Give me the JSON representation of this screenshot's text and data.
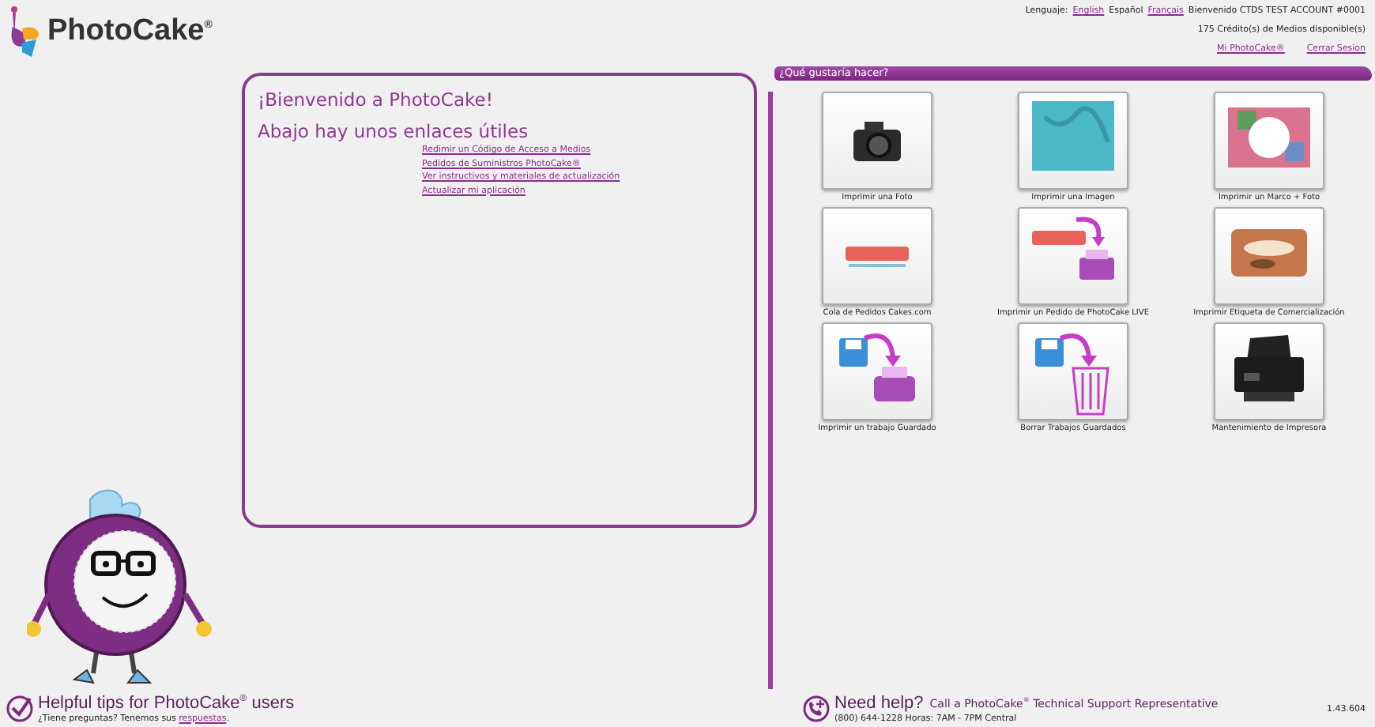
{
  "header": {
    "logo": "PhotoCake$^{®}$",
    "language_label": "Lenguaje:",
    "languages": [
      {
        "label": "English",
        "selected": false
      },
      {
        "label": "Español",
        "selected": true
      },
      {
        "label": "Français",
        "selected": false
      }
    ],
    "welcome_user": "Bienvenido CTDS TEST ACCOUNT #0001",
    "credits": "175 Crédito(s) de Medios disponible(s)",
    "links": [
      "Mi PhotoCake®",
      "Cerrar Sesion"
    ]
  },
  "welcome": {
    "title": "¡Bienvenido a PhotoCake!",
    "subtitle": "Abajo hay unos enlaces útiles",
    "links": [
      "Redimir un Código de Acceso a Medios",
      "Pedidos de Suministros PhotoCake®",
      "Ver instructivos y materiales de actualización",
      "Actualizar mi aplicación"
    ]
  },
  "tasks": {
    "title": "¿Qué gustaría hacer?",
    "items": [
      {
        "label": "Imprimir una Foto",
        "kind": "camera"
      },
      {
        "label": "Imprimir una Imagen",
        "kind": "image"
      },
      {
        "label": "Imprimir un Marco + Foto",
        "kind": "frame"
      },
      {
        "label": "Cola de Pedidos Cakes.com",
        "kind": "cakes"
      },
      {
        "label": "Imprimir un Pedido de PhotoCake LIVE",
        "kind": "cakes-print"
      },
      {
        "label": "Imprimir Etiqueta de Comercialización",
        "kind": "label"
      },
      {
        "label": "Imprimir un trabajo Guardado",
        "kind": "save-print"
      },
      {
        "label": "Borrar Trabajos Guardados",
        "kind": "save-delete"
      },
      {
        "label": "Mantenimiento de Impresora",
        "kind": "printer"
      }
    ]
  },
  "footer": {
    "tips_title": "Helpful tips for PhotoCake$^{®}$ users",
    "tips_text": "¿Tiene preguntas? Tenemos sus ",
    "tips_link": "respuestas",
    "tips_end": ".",
    "help_title": "Need help?",
    "help_text": "Call a PhotoCake$^{®}$ Technical Support Representative",
    "help_hours": "(800) 644-1228 Horas: 7AM - 7PM Central",
    "version": "1.43.604"
  }
}
